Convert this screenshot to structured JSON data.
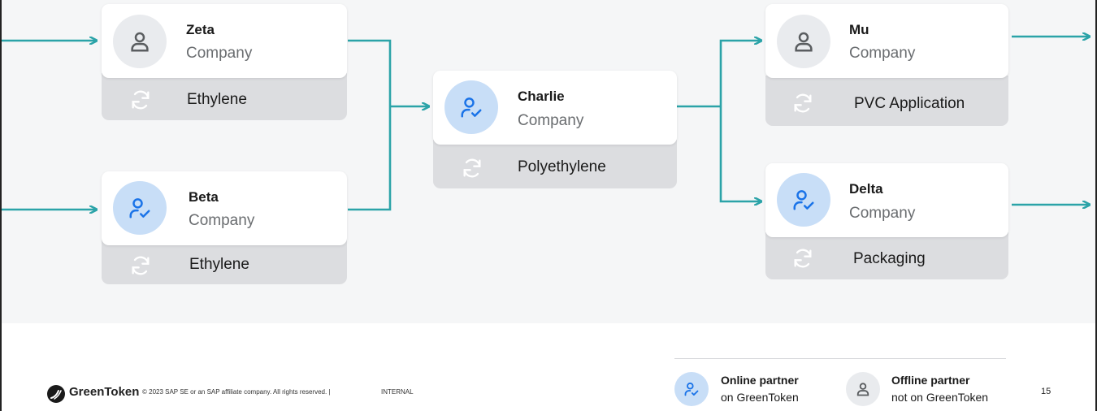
{
  "colors": {
    "connector": "#2ba3a8",
    "online_avatar_bg": "#c8def7",
    "online_icon": "#1a73e8",
    "offline_avatar_bg": "#e9ebee",
    "offline_icon": "#5a5d60",
    "product_strip": "#dcdde0"
  },
  "nodes": {
    "zeta": {
      "name": "Zeta",
      "type": "Company",
      "product": "Ethylene",
      "status": "offline",
      "icon": "user-icon"
    },
    "beta": {
      "name": "Beta",
      "type": "Company",
      "product": "Ethylene",
      "status": "online",
      "icon": "user-check-icon"
    },
    "charlie": {
      "name": "Charlie",
      "type": "Company",
      "product": "Polyethylene",
      "status": "online",
      "icon": "user-check-icon"
    },
    "mu": {
      "name": "Mu",
      "type": "Company",
      "product": "PVC Application",
      "status": "offline",
      "icon": "user-icon"
    },
    "delta": {
      "name": "Delta",
      "type": "Company",
      "product": "Packaging",
      "status": "online",
      "icon": "user-check-icon"
    }
  },
  "footer": {
    "brand": "GreenToken",
    "copyright": "© 2023 SAP SE or an SAP affiliate company. All rights reserved.  |",
    "classification": "INTERNAL",
    "page_number": "15"
  },
  "legend": {
    "online": {
      "title": "Online partner",
      "subtitle": "on GreenToken",
      "icon": "user-check-icon"
    },
    "offline": {
      "title": "Offline partner",
      "subtitle": "not on GreenToken",
      "icon": "user-icon"
    }
  }
}
